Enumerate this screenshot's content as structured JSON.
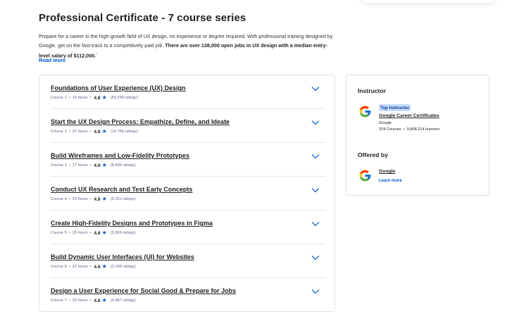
{
  "page_title": "Professional Certificate - 7 course series",
  "description": {
    "text": "Prepare for a career in the high-growth field of UX design, no experience or degree required. With professional training designed by Google, get on the fast-track to a competitively paid job. ",
    "bold": "There are over 138,000 open jobs in UX design with a median entry-level salary of $112,000.",
    "footnote": "¹"
  },
  "read_more": "Read more",
  "courses": [
    {
      "title": "Foundations of User Experience (UX) Design",
      "course": "Course 1",
      "hours": "19 hours",
      "rating": "4.8",
      "ratings": "(65,298 ratings)"
    },
    {
      "title": "Start the UX Design Process: Empathize, Define, and Ideate",
      "course": "Course 2",
      "hours": "21 hours",
      "rating": "4.8",
      "ratings": "(14,768 ratings)"
    },
    {
      "title": "Build Wireframes and Low-Fidelity Prototypes",
      "course": "Course 3",
      "hours": "17 hours",
      "rating": "4.9",
      "ratings": "(8,448 ratings)"
    },
    {
      "title": "Conduct UX Research and Test Early Concepts",
      "course": "Course 4",
      "hours": "20 hours",
      "rating": "4.8",
      "ratings": "(5,151 ratings)"
    },
    {
      "title": "Create High-Fidelity Designs and Prototypes in Figma",
      "course": "Course 5",
      "hours": "29 hours",
      "rating": "4.8",
      "ratings": "(3,969 ratings)"
    },
    {
      "title": "Build Dynamic User Interfaces (UI) for Websites",
      "course": "Course 6",
      "hours": "22 hours",
      "rating": "4.8",
      "ratings": "(3,198 ratings)"
    },
    {
      "title": "Design a User Experience for Social Good & Prepare for Jobs",
      "course": "Course 7",
      "hours": "26 hours",
      "rating": "4.8",
      "ratings": "(3,487 ratings)"
    }
  ],
  "instructor": {
    "heading": "Instructor",
    "badge": "Top Instructor",
    "name": "Google Career Certificates",
    "org": "Google",
    "courses": "324 Courses",
    "learners": "9,868,214 learners"
  },
  "offered_by": {
    "heading": "Offered by",
    "name": "Google",
    "learn_more": "Learn more"
  },
  "colors": {
    "link_blue": "#0056d2",
    "badge_bg": "#c7dcff",
    "border": "#dfe2e6",
    "google_blue": "#4285F4",
    "google_red": "#EA4335",
    "google_yellow": "#FBBC05",
    "google_green": "#34A853"
  },
  "icons": {
    "chevron": "chevron-down-icon",
    "star": "star-icon",
    "logo": "google-logo-icon"
  }
}
